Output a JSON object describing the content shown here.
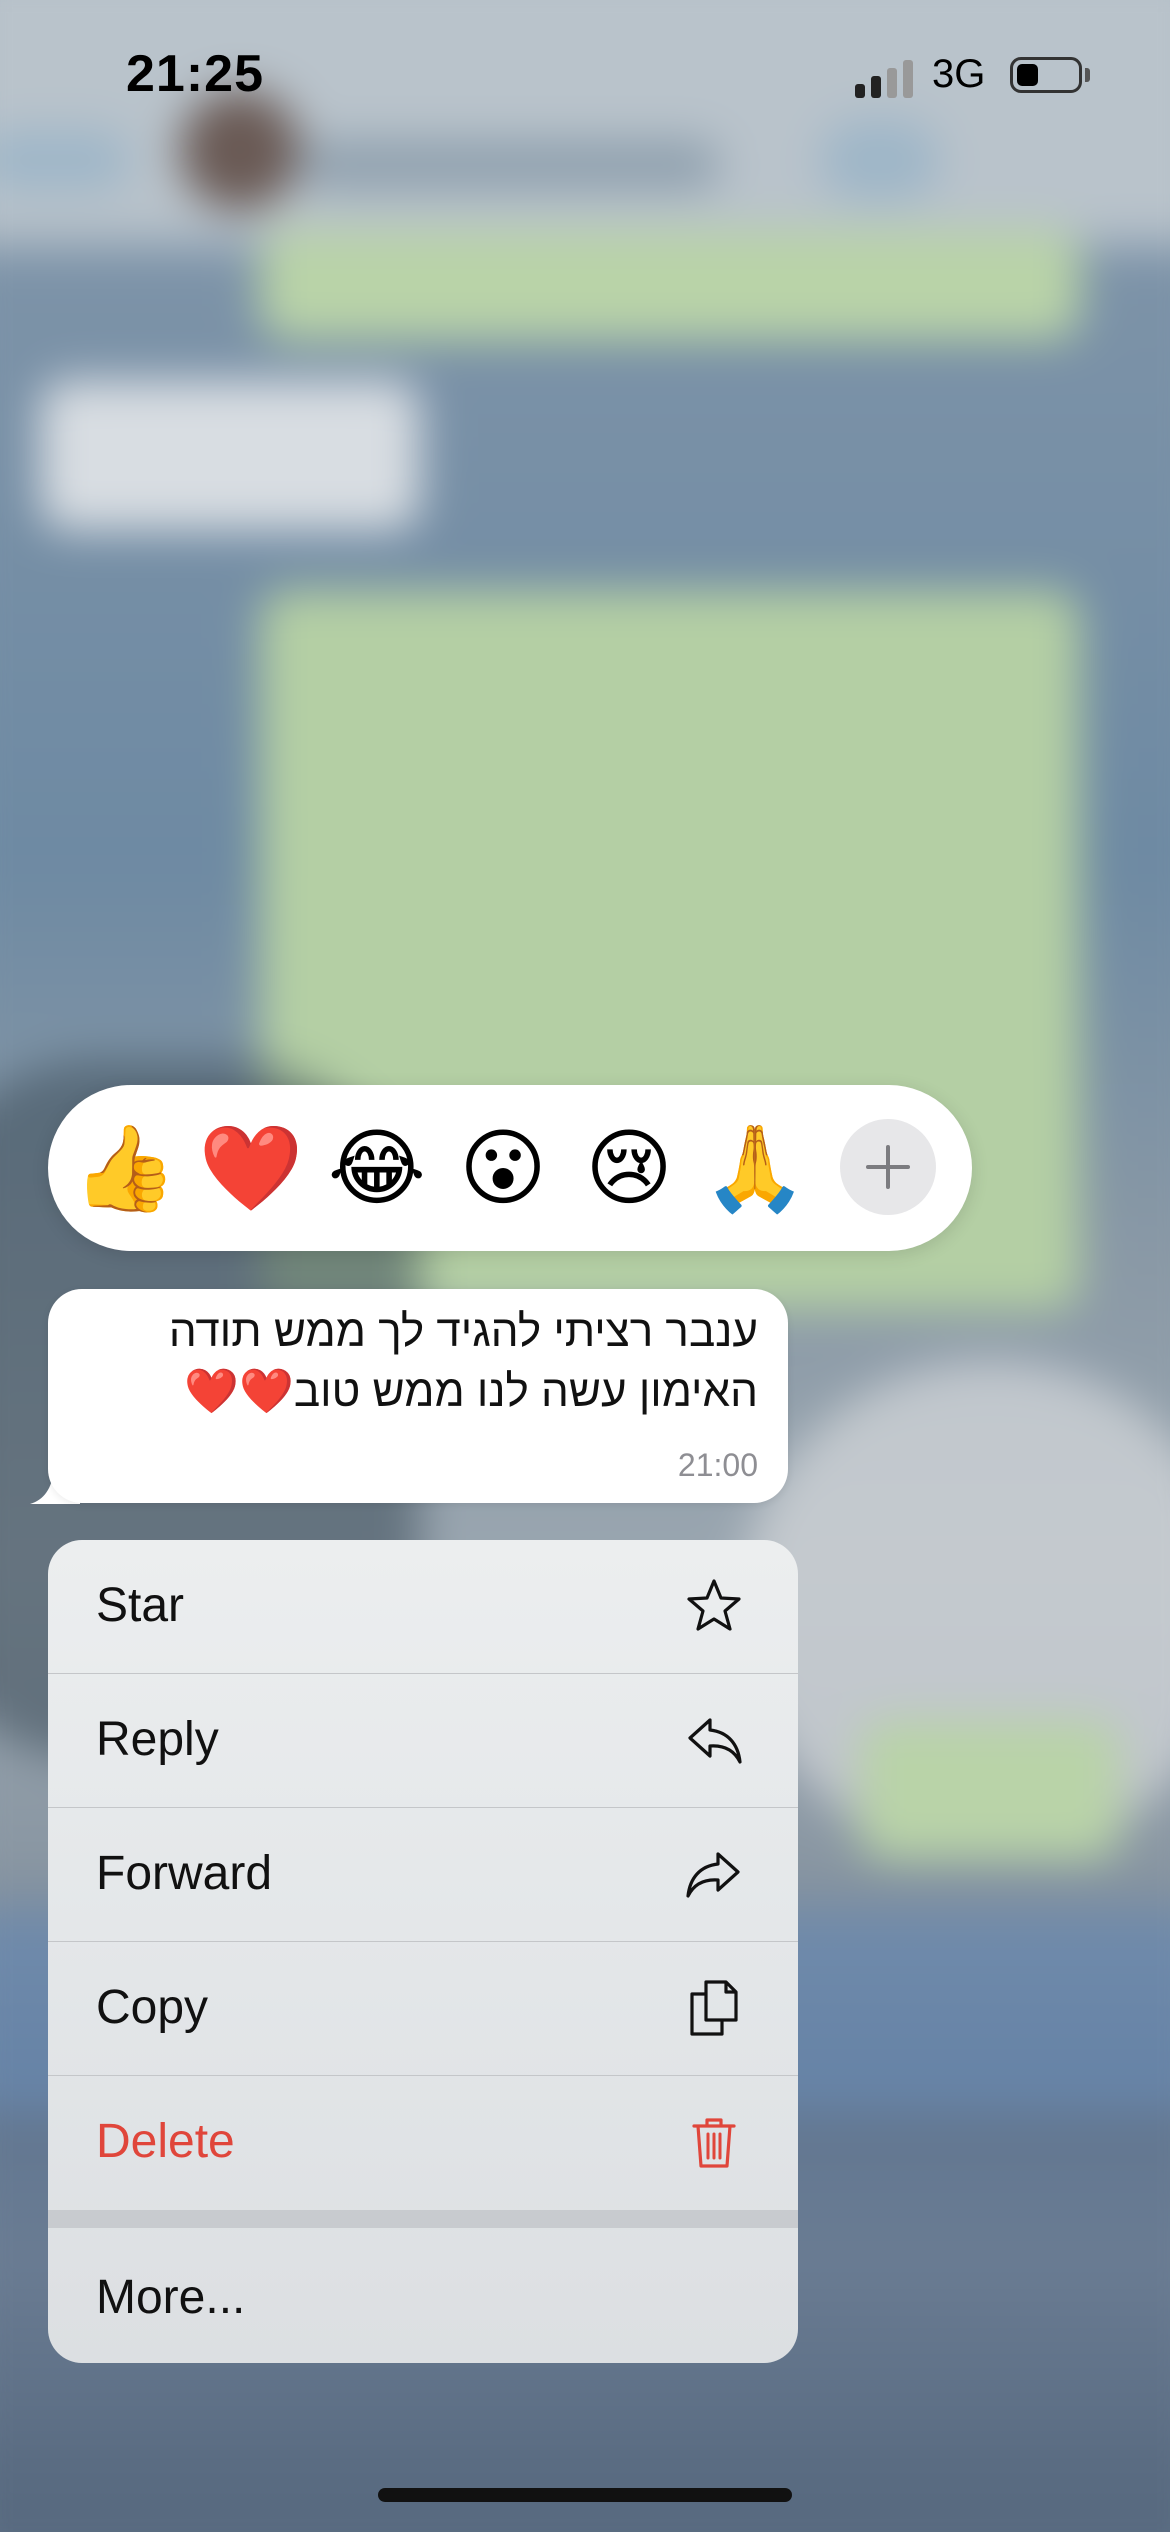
{
  "status_bar": {
    "time": "21:25",
    "network": "3G",
    "battery_percent": 35
  },
  "reactions": {
    "items": [
      {
        "emoji": "👍",
        "name": "thumbs-up"
      },
      {
        "emoji": "❤️",
        "name": "heart"
      },
      {
        "emoji": "😂",
        "name": "tears-of-joy"
      },
      {
        "emoji": "😮",
        "name": "surprised"
      },
      {
        "emoji": "😢",
        "name": "crying"
      },
      {
        "emoji": "🙏",
        "name": "folded-hands"
      }
    ],
    "more_icon": "plus-icon"
  },
  "message": {
    "line1": "ענבר רציתי להגיד לך ממש תודה",
    "line2": "האימון עשה לנו ממש טוב❤️❤️",
    "time": "21:00"
  },
  "menu": {
    "star": {
      "label": "Star",
      "icon": "star-icon"
    },
    "reply": {
      "label": "Reply",
      "icon": "reply-icon"
    },
    "forward": {
      "label": "Forward",
      "icon": "forward-icon"
    },
    "copy": {
      "label": "Copy",
      "icon": "copy-icon"
    },
    "delete": {
      "label": "Delete",
      "icon": "trash-icon",
      "color": "#e0463b"
    },
    "more": {
      "label": "More..."
    }
  }
}
